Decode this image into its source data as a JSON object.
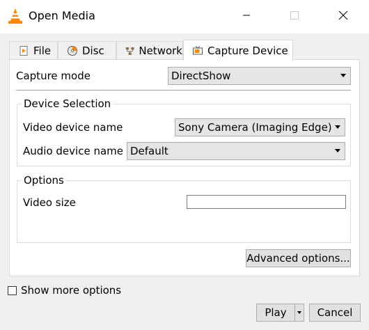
{
  "window": {
    "title": "Open Media",
    "app_icon": "vlc-cone-icon",
    "controls": [
      "minimize-icon",
      "maximize-icon",
      "close-icon"
    ]
  },
  "tabs": [
    {
      "label": "File",
      "icon": "file-icon",
      "active": false
    },
    {
      "label": "Disc",
      "icon": "disc-icon",
      "active": false
    },
    {
      "label": "Network",
      "icon": "network-icon",
      "active": false
    },
    {
      "label": "Capture Device",
      "icon": "capture-device-icon",
      "active": true
    }
  ],
  "capture": {
    "mode_label": "Capture mode",
    "mode_value": "DirectShow",
    "device_selection": {
      "title": "Device Selection",
      "video_label": "Video device name",
      "video_value": "Sony Camera (Imaging Edge)",
      "audio_label": "Audio device name",
      "audio_value": "Default"
    },
    "options": {
      "title": "Options",
      "video_size_label": "Video size",
      "video_size_value": ""
    },
    "advanced_button": "Advanced options..."
  },
  "footer": {
    "show_more_label": "Show more options",
    "show_more_checked": false,
    "play_label": "Play",
    "cancel_label": "Cancel"
  },
  "colors": {
    "accent_orange": "#ff8800",
    "window_bg": "#f0f0f0",
    "panel_bg": "#ffffff"
  }
}
